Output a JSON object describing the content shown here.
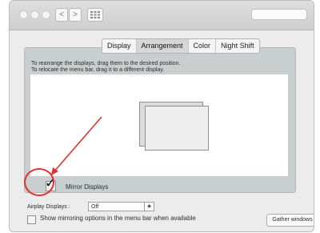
{
  "toolbar": {
    "nav_back": "<",
    "nav_forward": ">",
    "grid_icon": "grid-icon",
    "search_placeholder": ""
  },
  "tabs": [
    {
      "label": "Display",
      "active": false
    },
    {
      "label": "Arrangement",
      "active": true
    },
    {
      "label": "Color",
      "active": false
    },
    {
      "label": "Night Shift",
      "active": false
    }
  ],
  "arrangement": {
    "instruction_1": "To rearrange the displays, drag them to the desired position.",
    "instruction_2": "To relocate the menu bar, drag it to a different display."
  },
  "mirror": {
    "label": "Mirror Displays",
    "checked": true
  },
  "airplay": {
    "label": "Airplay Displays :",
    "value": "Off"
  },
  "show_mirroring": {
    "label": "Show mirroring options in the menu bar when available",
    "checked": false
  },
  "gather_button": "Gather windows",
  "annotation_color": "#e03030"
}
